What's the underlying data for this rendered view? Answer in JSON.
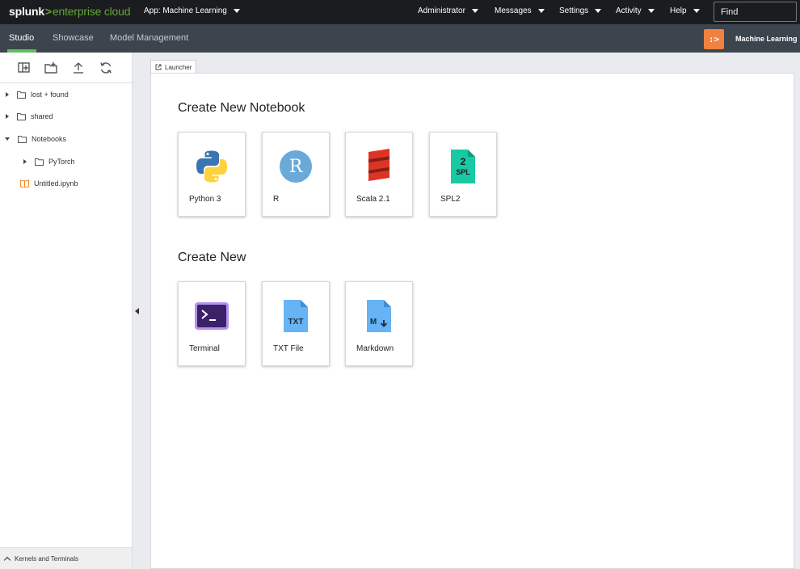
{
  "topbar": {
    "logo_brand": "splunk",
    "logo_chevron": ">",
    "logo_product": "enterprise cloud",
    "app_menu": "App: Machine Learning",
    "menus": [
      "Administrator",
      "Messages",
      "Settings",
      "Activity",
      "Help"
    ],
    "find_placeholder": "Find"
  },
  "appbar": {
    "tabs": [
      "Studio",
      "Showcase",
      "Model Management"
    ],
    "active_tab": "Studio",
    "app_logo_glyph": ":>",
    "app_logo_color": "#f1813f",
    "app_title": "Machine Learning"
  },
  "filebrowser": {
    "toolbar": [
      "new-launcher-icon",
      "new-folder-icon",
      "upload-icon",
      "refresh-icon"
    ],
    "items": [
      {
        "label": "lost + found",
        "type": "folder",
        "expanded": false
      },
      {
        "label": "shared",
        "type": "folder",
        "expanded": false
      },
      {
        "label": "Notebooks",
        "type": "folder",
        "expanded": true
      },
      {
        "label": "PyTorch",
        "type": "folder",
        "expanded": false
      },
      {
        "label": "Untitled.ipynb",
        "type": "notebook"
      }
    ],
    "status": "Kernels and Terminals"
  },
  "launcher": {
    "tab_label": "Launcher",
    "sections": [
      {
        "title": "Create New Notebook",
        "cards": [
          {
            "label": "Python 3",
            "icon": "python-icon"
          },
          {
            "label": "R",
            "icon": "r-icon",
            "glyph": "R"
          },
          {
            "label": "Scala 2.1",
            "icon": "scala-icon"
          },
          {
            "label": "SPL2",
            "icon": "spl2-icon",
            "glyph_top": "2",
            "glyph_bottom": "SPL"
          }
        ]
      },
      {
        "title": "Create New",
        "cards": [
          {
            "label": "Terminal",
            "icon": "terminal-icon"
          },
          {
            "label": "TXT File",
            "icon": "txt-file-icon",
            "glyph": "TXT"
          },
          {
            "label": "Markdown",
            "icon": "markdown-icon",
            "glyph": "M"
          }
        ]
      }
    ]
  },
  "colors": {
    "topbar": "#1a1c20",
    "appbar": "#3c444d",
    "brand_green": "#65a637",
    "active_underline": "#5cc05c"
  }
}
